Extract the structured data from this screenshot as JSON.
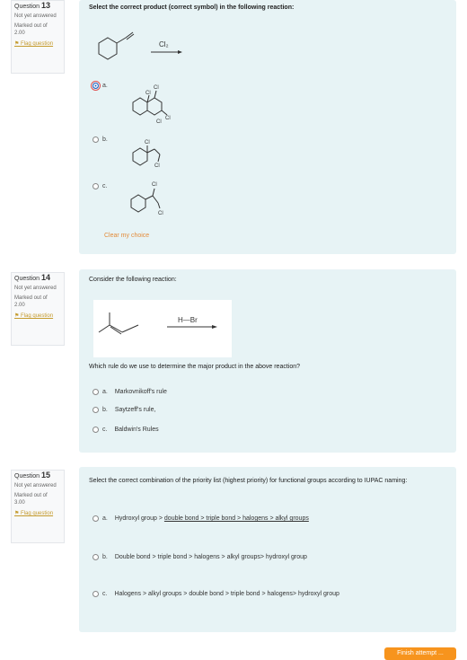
{
  "questions": [
    {
      "label": "Question",
      "number": "13",
      "status": "Not yet answered",
      "marked": "Marked out of",
      "marks": "2.00",
      "flag": "Flag question",
      "text": "Select the correct product (correct symbol) in the following reaction:",
      "reagent": "Cl₂",
      "options": [
        {
          "letter": "a."
        },
        {
          "letter": "b."
        },
        {
          "letter": "c."
        }
      ],
      "atom_label": "Cl",
      "clear": "Clear my choice"
    },
    {
      "label": "Question",
      "number": "14",
      "status": "Not yet answered",
      "marked": "Marked out of",
      "marks": "2.00",
      "flag": "Flag question",
      "text": "Consider the following reaction:",
      "reagent": "H—Br",
      "prompt": "Which rule do we use to determine the major product in the above reaction?",
      "options": [
        {
          "letter": "a.",
          "text": "Markovnikoff's rule"
        },
        {
          "letter": "b.",
          "text": "Saytzeff's rule,"
        },
        {
          "letter": "c.",
          "text": "Baldwin's Rules"
        }
      ]
    },
    {
      "label": "Question",
      "number": "15",
      "status": "Not yet answered",
      "marked": "Marked out of",
      "marks": "3.00",
      "flag": "Flag question",
      "text": "Select the correct combination of the priority list (highest priority) for functional groups according to IUPAC naming:",
      "options": [
        {
          "letter": "a.",
          "prefix": "Hydroxyl group > ",
          "underlined": "double bond > triple bond > halogens > alkyl groups"
        },
        {
          "letter": "b.",
          "text": "Double bond > triple bond > halogens > alkyl groups> hydroxyl group"
        },
        {
          "letter": "c.",
          "text": "Halogens > alkyl groups > double bond > triple bond > halogens> hydroxyl group"
        }
      ]
    }
  ],
  "finish": "Finish attempt ..."
}
